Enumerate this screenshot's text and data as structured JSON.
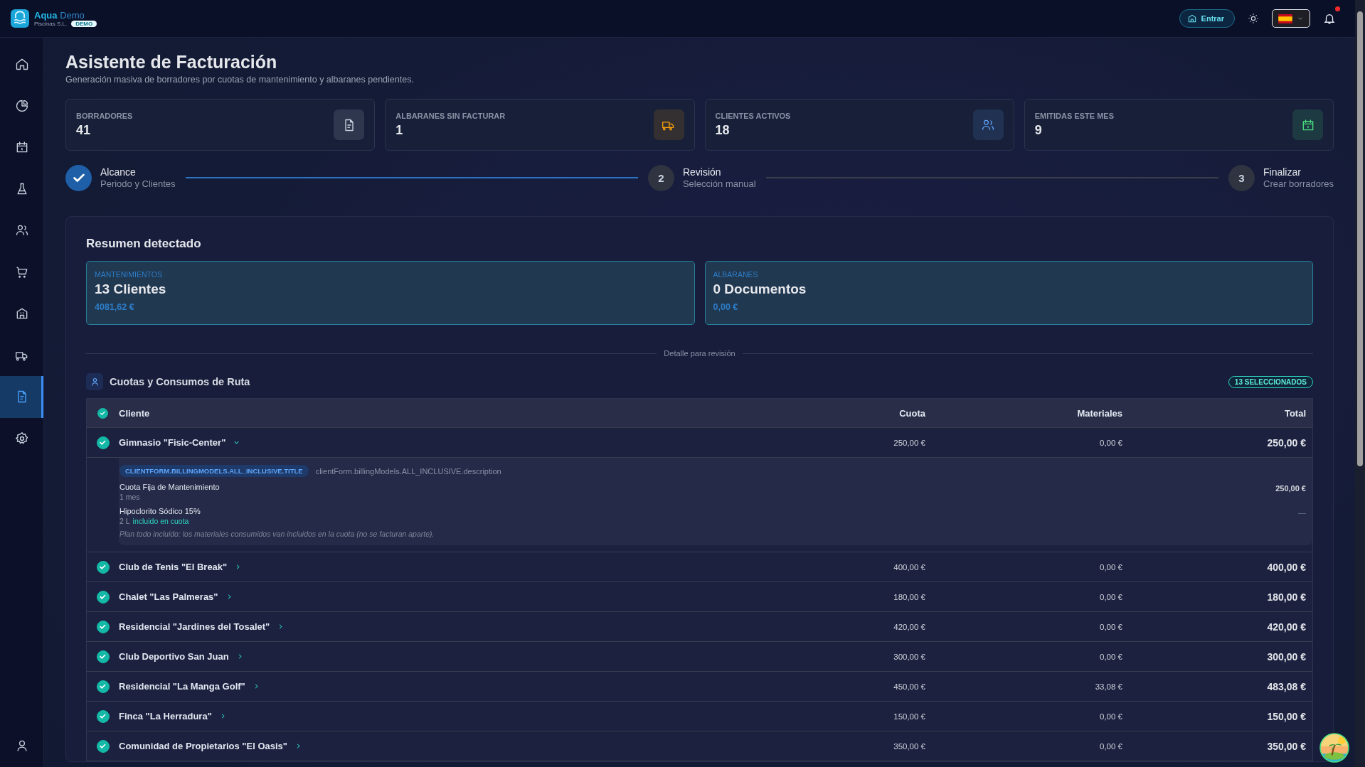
{
  "header": {
    "brand": {
      "name": "Aqua",
      "name_accent": "Demo",
      "company": "Piscinas S.L.",
      "badge": "DEMO"
    },
    "login_button": "Entrar",
    "notifications": {
      "unread": true
    }
  },
  "sidebar": {
    "items": [
      {
        "kind": "home",
        "selected": false
      },
      {
        "kind": "chart",
        "selected": false
      },
      {
        "kind": "calendar",
        "selected": false
      },
      {
        "kind": "flask",
        "selected": false
      },
      {
        "kind": "users",
        "selected": false
      },
      {
        "kind": "cart",
        "selected": false
      },
      {
        "kind": "building",
        "selected": false
      },
      {
        "kind": "truck",
        "selected": false
      },
      {
        "kind": "document",
        "selected": true
      },
      {
        "kind": "gear",
        "selected": false
      }
    ]
  },
  "page": {
    "title": "Asistente de Facturación",
    "subtitle": "Generación masiva de borradores por cuotas de mantenimiento y albaranes pendientes."
  },
  "stats": [
    {
      "label": "BORRADORES",
      "value": "41",
      "kind": "document",
      "color": "#cbd5e1"
    },
    {
      "label": "ALBARANES SIN FACTURAR",
      "value": "1",
      "kind": "truck",
      "color": "#f59e0b"
    },
    {
      "label": "CLIENTES ACTIVOS",
      "value": "18",
      "kind": "users",
      "color": "#60a5fa"
    },
    {
      "label": "EMITIDAS ESTE MES",
      "value": "9",
      "kind": "calendar",
      "color": "#4ade80"
    }
  ],
  "steps": [
    {
      "title": "Alcance",
      "subtitle": "Periodo y Clientes",
      "done": true
    },
    {
      "number": "2",
      "title": "Revisión",
      "subtitle": "Selección manual",
      "done": false
    },
    {
      "number": "3",
      "title": "Finalizar",
      "subtitle": "Crear borradores",
      "done": false
    }
  ],
  "summary": {
    "title": "Resumen detectado",
    "cards": [
      {
        "label": "MANTENIMIENTOS",
        "count": "13 Clientes",
        "amount": "4081,62 €"
      },
      {
        "label": "ALBARANES",
        "count": "0 Documentos",
        "amount": "0,00 €"
      }
    ],
    "divider_label": "Detalle para revisión"
  },
  "section": {
    "title": "Cuotas y Consumos de Ruta",
    "badge": "13 SELECCIONADOS"
  },
  "table": {
    "all_checked": true,
    "columns": [
      "Cliente",
      "Cuota",
      "Materiales",
      "Total"
    ],
    "rows": [
      {
        "client": "Gimnasio \"Fisic-Center\"",
        "cuota": "250,00 €",
        "materiales": "0,00 €",
        "total": "250,00 €",
        "checked": true,
        "expanded": true,
        "detail": {
          "tag": "CLIENTFORM.BILLINGMODELS.ALL_INCLUSIVE.TITLE",
          "description": "clientForm.billingModels.ALL_INCLUSIVE.description",
          "lines": [
            {
              "name": "Cuota Fija de Mantenimiento",
              "qty": "1 mes",
              "amount": "250,00 €"
            },
            {
              "name": "Hipoclorito Sódico 15%",
              "qty": "2 L",
              "included": "incluido en cuota",
              "amount": "—"
            }
          ],
          "note": "Plan todo incluido: los materiales consumidos van incluidos en la cuota (no se facturan aparte)."
        }
      },
      {
        "client": "Club de Tenis \"El Break\"",
        "cuota": "400,00 €",
        "materiales": "0,00 €",
        "total": "400,00 €",
        "checked": true,
        "expanded": false
      },
      {
        "client": "Chalet \"Las Palmeras\"",
        "cuota": "180,00 €",
        "materiales": "0,00 €",
        "total": "180,00 €",
        "checked": true,
        "expanded": false
      },
      {
        "client": "Residencial \"Jardines del Tosalet\"",
        "cuota": "420,00 €",
        "materiales": "0,00 €",
        "total": "420,00 €",
        "checked": true,
        "expanded": false
      },
      {
        "client": "Club Deportivo San Juan",
        "cuota": "300,00 €",
        "materiales": "0,00 €",
        "total": "300,00 €",
        "checked": true,
        "expanded": false
      },
      {
        "client": "Residencial \"La Manga Golf\"",
        "cuota": "450,00 €",
        "materiales": "33,08 €",
        "total": "483,08 €",
        "checked": true,
        "expanded": false
      },
      {
        "client": "Finca \"La Herradura\"",
        "cuota": "150,00 €",
        "materiales": "0,00 €",
        "total": "150,00 €",
        "checked": true,
        "expanded": false
      },
      {
        "client": "Comunidad de Propietarios \"El Oasis\"",
        "cuota": "350,00 €",
        "materiales": "0,00 €",
        "total": "350,00 €",
        "checked": true,
        "expanded": false
      }
    ]
  }
}
